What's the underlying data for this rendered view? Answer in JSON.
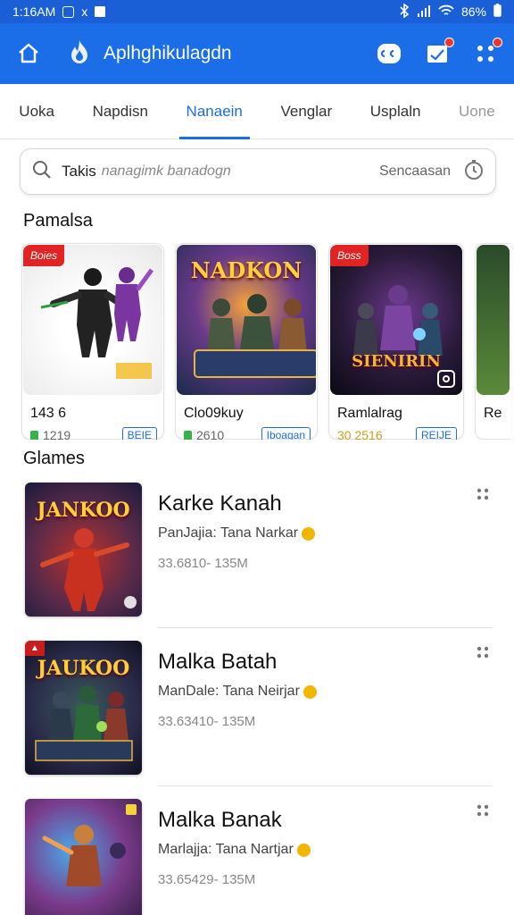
{
  "status_bar": {
    "time": "1:16AM",
    "x_mark": "x",
    "battery": "86%"
  },
  "app_bar": {
    "title": "Aplhghikulagdn"
  },
  "tabs": [
    {
      "label": "Uoka"
    },
    {
      "label": "Napdisn"
    },
    {
      "label": "Nanaein",
      "active": true
    },
    {
      "label": "Venglar"
    },
    {
      "label": "Usplaln"
    },
    {
      "label": "Uone"
    }
  ],
  "search": {
    "query": "Takis",
    "placeholder": "nanagimk banadogn",
    "right_label": "Sencaasan"
  },
  "featured": {
    "title": "Pamalsa",
    "cards": [
      {
        "badge": "Boies",
        "art_text": "",
        "name": "143 6",
        "meta": "1219",
        "tag": "BEIE"
      },
      {
        "badge": "",
        "art_text": "NADKON",
        "name": "Clo09kuy",
        "meta": "2610",
        "tag": "Iboagan"
      },
      {
        "badge": "Boss",
        "art_text": "SIENIRIN",
        "name": "Ramlalrag",
        "meta": "30 2516",
        "tag": "REIJE"
      },
      {
        "badge": "",
        "art_text": "",
        "name": "Re",
        "meta": "",
        "tag": ""
      }
    ]
  },
  "games": {
    "title": "Glames",
    "items": [
      {
        "thumb_text": "JANKOO",
        "title": "Karke Kanah",
        "developer": "PanJajia: Tana Narkar",
        "size": "33.6810- 135M"
      },
      {
        "thumb_text": "JAUKOO",
        "title": "Malka Batah",
        "developer": "ManDale: Tana Neirjar",
        "size": "33.63410- 135M"
      },
      {
        "thumb_text": "",
        "title": "Malka Banak",
        "developer": "Marlajja: Tana Nartjar",
        "size": "33.65429- 135M"
      }
    ]
  },
  "colors": {
    "primary": "#1c6ee8",
    "status_bar": "#1a5fd6",
    "badge_red": "#e02323",
    "verified": "#f2b500"
  }
}
